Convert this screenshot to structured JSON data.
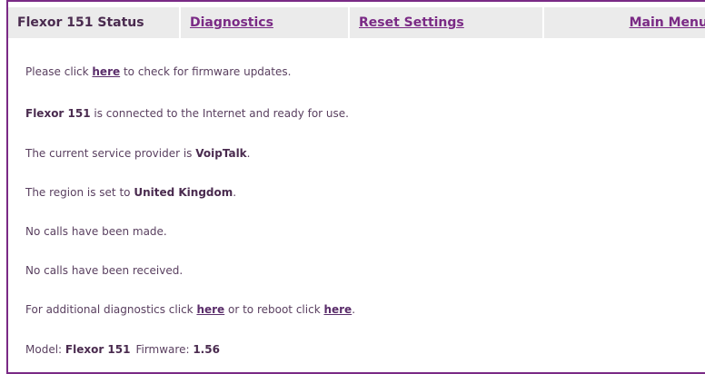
{
  "nav": {
    "status_label": "Flexor 151 Status",
    "diagnostics_label": "Diagnostics",
    "reset_label": "Reset Settings",
    "main_menu_label": "Main Menu"
  },
  "content": {
    "firmware_line": {
      "pre": "Please click ",
      "link": "here",
      "post": " to check for firmware updates."
    },
    "connected_line": {
      "device": "Flexor 151",
      "post": " is connected to the Internet and ready for use."
    },
    "provider_line": {
      "pre": "The current service provider is ",
      "value": "VoipTalk",
      "post": "."
    },
    "region_line": {
      "pre": "The region is set to ",
      "value": "United Kingdom",
      "post": "."
    },
    "calls_made": "No calls have been made.",
    "calls_received": "No calls have been received.",
    "diag_line": {
      "pre": "For additional diagnostics click ",
      "link1": "here",
      "mid": " or to reboot click ",
      "link2": "here",
      "post": "."
    },
    "model_line": {
      "model_label": "Model: ",
      "model": "Flexor 151",
      "firmware_label": "Firmware: ",
      "firmware": "1.56"
    }
  },
  "colors": {
    "accent": "#7a2a85",
    "nav_bg": "#ebebeb",
    "text": "#5a4060"
  }
}
